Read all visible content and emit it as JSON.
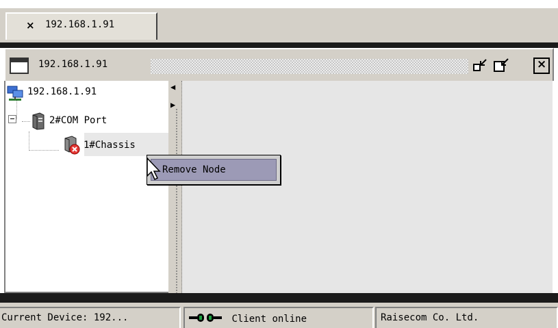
{
  "tab": {
    "close_glyph": "×",
    "title": "192.168.1.91"
  },
  "frame": {
    "title": "192.168.1.91",
    "icons": [
      "window-icon",
      "restore-icon",
      "maximize-icon",
      "close-icon"
    ]
  },
  "tree": {
    "root": {
      "label": "192.168.1.91",
      "icon": "network-computer-icon"
    },
    "port": {
      "label": "2#COM Port",
      "icon": "server-tower-icon",
      "expander": "⊟"
    },
    "chassis": {
      "label": "1#Chassis",
      "icon": "chassis-error-icon"
    }
  },
  "splitter": {
    "left_arrow": "◀",
    "right_arrow": "▶"
  },
  "context_menu": {
    "items": [
      {
        "label": "Remove Node"
      }
    ]
  },
  "status_bar": {
    "device": "Current Device: 192...",
    "client": "Client online",
    "client_icon": "connection-plug-icon",
    "company": "Raisecom Co. Ltd."
  },
  "colors": {
    "panel_bg": "#d4d0c8",
    "menu_highlight": "#9c9ab6",
    "dark_separator": "#1b1b1b"
  }
}
